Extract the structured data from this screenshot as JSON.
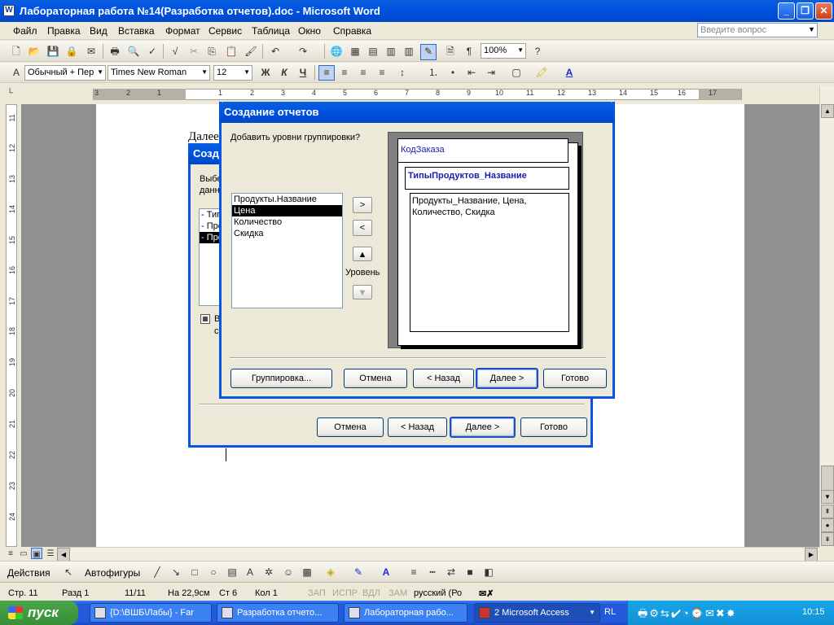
{
  "window": {
    "title": "Лабораторная работа №14(Разработка отчетов).doc - Microsoft Word",
    "app_icon": "W",
    "controls": {
      "minimize": "_",
      "maximize": "❐",
      "close": "✕"
    }
  },
  "menubar": {
    "items": [
      "Файл",
      "Правка",
      "Вид",
      "Вставка",
      "Формат",
      "Сервис",
      "Таблица",
      "Окно",
      "Справка"
    ],
    "ask_placeholder": "Введите вопрос"
  },
  "toolbar_formatting": {
    "style": "Обычный + Пер",
    "font": "Times New Roman",
    "size": "12",
    "bold": "Ж",
    "italic": "К",
    "underline": "Ч"
  },
  "toolbar_standard": {
    "zoom": "100%",
    "paragraph_mark": "¶"
  },
  "ruler": {
    "h_ticks": [
      "3",
      "2",
      "1",
      "1",
      "2",
      "3",
      "4",
      "5",
      "6",
      "7",
      "8",
      "9",
      "10",
      "11",
      "12",
      "13",
      "14",
      "15",
      "16",
      "17"
    ],
    "v_ticks": [
      "11",
      "12",
      "13",
      "14",
      "15",
      "16",
      "17",
      "18",
      "19",
      "20",
      "21",
      "22",
      "23",
      "24"
    ]
  },
  "document": {
    "visible_text": "Далее"
  },
  "back_dialog": {
    "title": "Созда",
    "prompt_lines": [
      "Выбе",
      "данн"
    ],
    "list_items": [
      "- Тип",
      "- Про",
      "- Про"
    ],
    "check_label_lines": [
      "В",
      "с"
    ],
    "buttons": {
      "cancel": "Отмена",
      "back": "< Назад",
      "next": "Далее >",
      "finish": "Готово"
    }
  },
  "dialog": {
    "title": "Создание отчетов",
    "prompt": "Добавить уровни группировки?",
    "fields": [
      "Продукты.Название",
      "Цена",
      "Количество",
      "Скидка"
    ],
    "selected_field": "Цена",
    "btn_add": ">",
    "btn_remove": "<",
    "priority_label": "Уровень",
    "preview": {
      "level1": "КодЗаказа",
      "level2": "ТипыПродуктов_Название",
      "detail_lines": [
        "Продукты_Название, Цена,",
        "Количество, Скидка"
      ]
    },
    "buttons": {
      "grouping": "Группировка...",
      "cancel": "Отмена",
      "back": "< Назад",
      "next": "Далее >",
      "finish": "Готово"
    }
  },
  "drawing_toolbar": {
    "actions": "Действия",
    "autoshapes": "Автофигуры"
  },
  "statusbar": {
    "page": "Стр. 11",
    "section": "Разд 1",
    "pages": "11/11",
    "position": "На 22,9см",
    "line": "Ст 6",
    "column": "Кол 1",
    "rec": "ЗАП",
    "trk": "ИСПР",
    "ext": "ВДЛ",
    "ovr": "ЗАМ",
    "language": "русский (Ро"
  },
  "taskbar": {
    "start": "пуск",
    "tasks": [
      "{D:\\ВШБ\\Лабы} - Far",
      "Разработка отчето...",
      "Лабораторная рабо...",
      "2 Microsoft Access"
    ],
    "lang": "RL",
    "clock": "10:15"
  },
  "colors": {
    "xp_blue": "#0054e3",
    "taskbar_green": "#378f37",
    "preview_text": "#1a1ab0"
  }
}
